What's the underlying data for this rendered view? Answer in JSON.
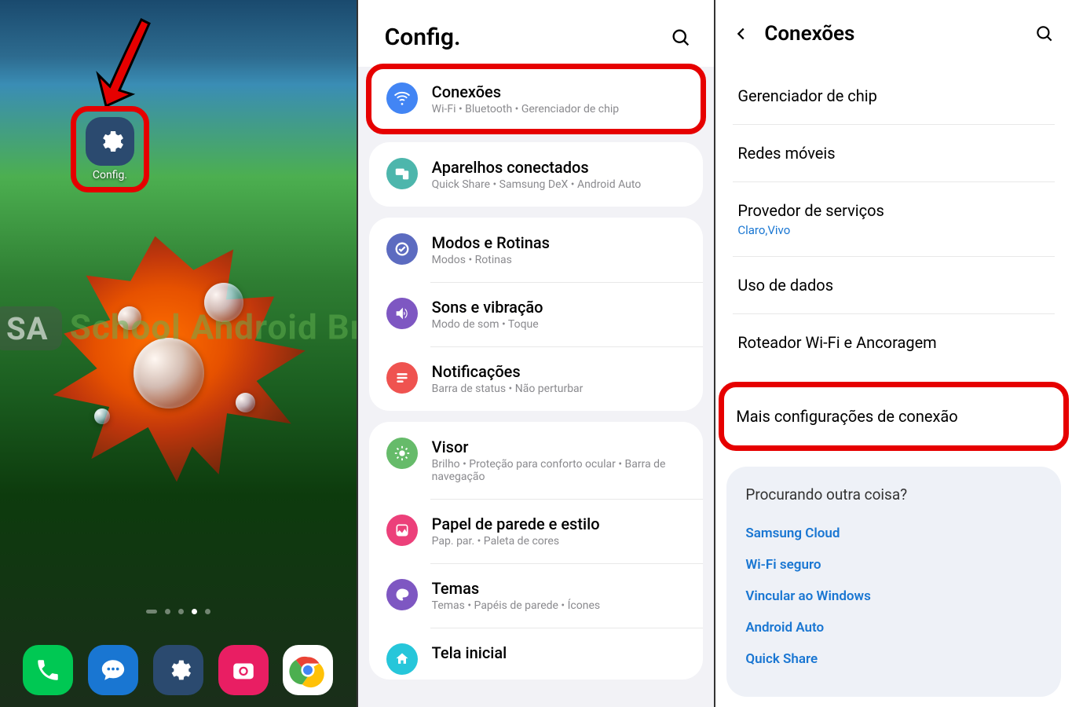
{
  "watermark_text": "School Android Br",
  "home": {
    "settings_label": "Config."
  },
  "settings": {
    "title": "Config.",
    "items": {
      "connections": {
        "title": "Conexões",
        "sub": "Wi-Fi • Bluetooth • Gerenciador de chip"
      },
      "devices": {
        "title": "Aparelhos conectados",
        "sub": "Quick Share • Samsung DeX • Android Auto"
      },
      "modes": {
        "title": "Modos e Rotinas",
        "sub": "Modos • Rotinas"
      },
      "sound": {
        "title": "Sons e vibração",
        "sub": "Modo de som • Toque"
      },
      "notif": {
        "title": "Notificações",
        "sub": "Barra de status • Não perturbar"
      },
      "display": {
        "title": "Visor",
        "sub": "Brilho • Proteção para conforto ocular • Barra de navegação"
      },
      "wallpaper": {
        "title": "Papel de parede e estilo",
        "sub": "Pap. par. • Paleta de cores"
      },
      "themes": {
        "title": "Temas",
        "sub": "Temas • Papéis de parede • Ícones"
      },
      "homescreen": {
        "title": "Tela inicial"
      }
    }
  },
  "connections": {
    "title": "Conexões",
    "items": {
      "sim": {
        "title": "Gerenciador de chip"
      },
      "mobile": {
        "title": "Redes móveis"
      },
      "provider": {
        "title": "Provedor de serviços",
        "sub": "Claro,Vivo"
      },
      "data": {
        "title": "Uso de dados"
      },
      "hotspot": {
        "title": "Roteador Wi-Fi e Ancoragem"
      },
      "more": {
        "title": "Mais configurações de conexão"
      }
    },
    "suggest": {
      "title": "Procurando outra coisa?",
      "links": [
        "Samsung Cloud",
        "Wi-Fi seguro",
        "Vincular ao Windows",
        "Android Auto",
        "Quick Share"
      ]
    }
  }
}
